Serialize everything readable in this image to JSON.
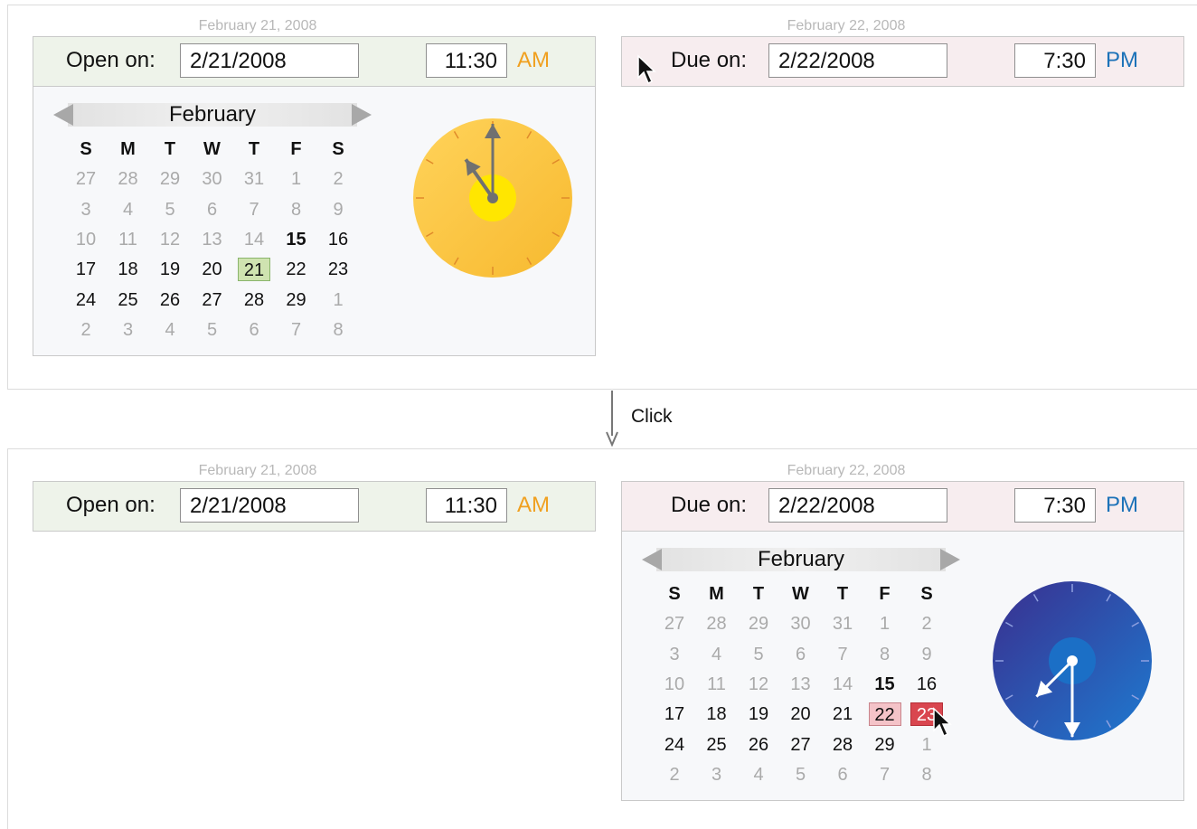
{
  "top_state": {
    "open": {
      "caption": "February 21, 2008",
      "label": "Open on:",
      "date_value": "2/21/2008",
      "time_value": "11:30",
      "ampm": "AM"
    },
    "due": {
      "caption": "February 22, 2008",
      "label": "Due on:",
      "date_value": "2/22/2008",
      "time_value": "7:30",
      "ampm": "PM"
    },
    "calendar": {
      "month": "February",
      "weekdays": [
        "S",
        "M",
        "T",
        "W",
        "T",
        "F",
        "S"
      ],
      "rows": [
        [
          "27",
          "28",
          "29",
          "30",
          "31",
          "1",
          "2"
        ],
        [
          "3",
          "4",
          "5",
          "6",
          "7",
          "8",
          "9"
        ],
        [
          "10",
          "11",
          "12",
          "13",
          "14",
          "15",
          "16"
        ],
        [
          "17",
          "18",
          "19",
          "20",
          "21",
          "22",
          "23"
        ],
        [
          "24",
          "25",
          "26",
          "27",
          "28",
          "29",
          "1"
        ],
        [
          "2",
          "3",
          "4",
          "5",
          "6",
          "7",
          "8"
        ]
      ],
      "today": "15",
      "selected": "21"
    },
    "clock": {
      "hour": 11,
      "minute": 30,
      "period": "AM",
      "face_color": "#ffc94a"
    }
  },
  "transition": {
    "label": "Click"
  },
  "bottom_state": {
    "open": {
      "caption": "February 21, 2008",
      "label": "Open on:",
      "date_value": "2/21/2008",
      "time_value": "11:30",
      "ampm": "AM"
    },
    "due": {
      "caption": "February 22, 2008",
      "label": "Due on:",
      "date_value": "2/22/2008",
      "time_value": "7:30",
      "ampm": "PM"
    },
    "calendar": {
      "month": "February",
      "weekdays": [
        "S",
        "M",
        "T",
        "W",
        "T",
        "F",
        "S"
      ],
      "rows": [
        [
          "27",
          "28",
          "29",
          "30",
          "31",
          "1",
          "2"
        ],
        [
          "3",
          "4",
          "5",
          "6",
          "7",
          "8",
          "9"
        ],
        [
          "10",
          "11",
          "12",
          "13",
          "14",
          "15",
          "16"
        ],
        [
          "17",
          "18",
          "19",
          "20",
          "21",
          "22",
          "23"
        ],
        [
          "24",
          "25",
          "26",
          "27",
          "28",
          "29",
          "1"
        ],
        [
          "2",
          "3",
          "4",
          "5",
          "6",
          "7",
          "8"
        ]
      ],
      "today": "15",
      "selected": "22",
      "hovered": "23"
    },
    "clock": {
      "hour": 7,
      "minute": 30,
      "period": "PM",
      "face_color": "#2e3f9e"
    }
  },
  "colors": {
    "open_bar": "#eef3ea",
    "due_bar": "#f7edef",
    "am_text": "#f0a020",
    "pm_text": "#1c72b8",
    "selected_open": "#cfe3b0",
    "selected_due": "#f4c3c8",
    "hover_due": "#d9464f"
  }
}
